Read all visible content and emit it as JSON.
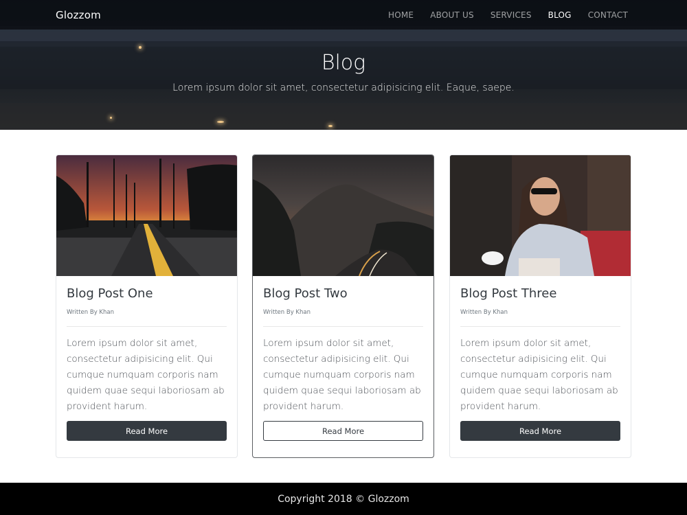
{
  "navbar": {
    "brand": "Glozzom",
    "links": [
      {
        "label": "HOME"
      },
      {
        "label": "ABOUT US"
      },
      {
        "label": "SERVICES"
      },
      {
        "label": "BLOG"
      },
      {
        "label": "CONTACT"
      }
    ],
    "active_index": 3
  },
  "hero": {
    "title": "Blog",
    "subtitle": "Lorem ipsum dolor sit amet, consectetur adipisicing elit. Eaque, saepe."
  },
  "posts": [
    {
      "title": "Blog Post One",
      "author": "Written By Khan",
      "text": "Lorem ipsum dolor sit amet, consectetur adipisicing elit. Qui cumque numquam corporis nam quidem quae sequi laboriosam ab provident harum.",
      "button": "Read More",
      "image_icon": "road-sunset-photo"
    },
    {
      "title": "Blog Post Two",
      "author": "Written By Khan",
      "text": "Lorem ipsum dolor sit amet, consectetur adipisicing elit. Qui cumque numquam corporis nam quidem quae sequi laboriosam ab provident harum.",
      "button": "Read More",
      "image_icon": "mountain-road-photo"
    },
    {
      "title": "Blog Post Three",
      "author": "Written By Khan",
      "text": "Lorem ipsum dolor sit amet, consectetur adipisicing elit. Qui cumque numquam corporis nam quidem quae sequi laboriosam ab provident harum.",
      "button": "Read More",
      "image_icon": "woman-cafe-photo"
    }
  ],
  "footer": {
    "copyright": "Copyright 2018 © Glozzom"
  },
  "colors": {
    "dark": "#343a40",
    "footer_bg": "#000000",
    "navbar_bg": "#0a0c10"
  }
}
